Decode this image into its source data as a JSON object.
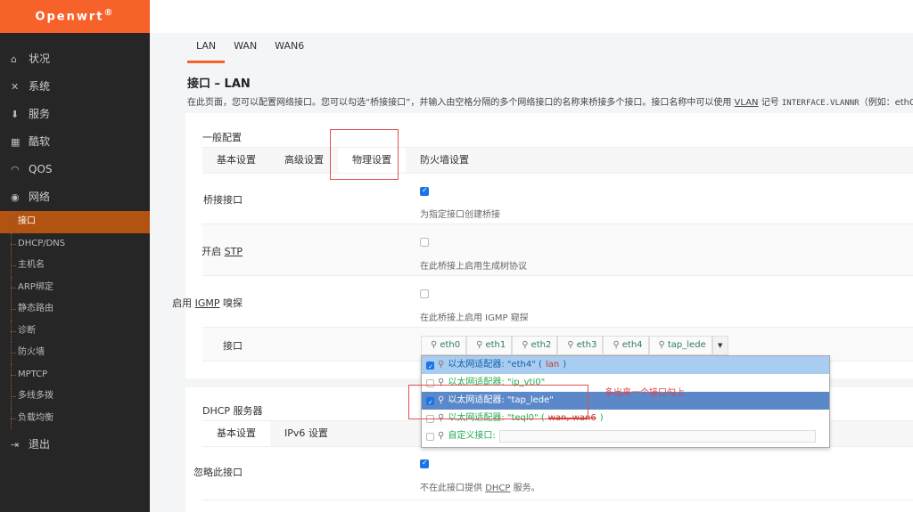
{
  "brand": {
    "name": "Openwrt",
    "mark": "®",
    "color": "#f6622a"
  },
  "sidebar": {
    "items": [
      {
        "icon": "home-icon",
        "glyph": "⌂",
        "label": "状况"
      },
      {
        "icon": "tools-icon",
        "glyph": "✕",
        "label": "系统"
      },
      {
        "icon": "download-icon",
        "glyph": "⬇",
        "label": "服务"
      },
      {
        "icon": "calendar-icon",
        "glyph": "▦",
        "label": "酷软"
      },
      {
        "icon": "gauge-icon",
        "glyph": "◠",
        "label": "QOS"
      },
      {
        "icon": "globe-icon",
        "glyph": "◉",
        "label": "网络"
      }
    ],
    "subitems": [
      "接口",
      "DHCP/DNS",
      "主机名",
      "ARP绑定",
      "静态路由",
      "诊断",
      "防火墙",
      "MPTCP",
      "多线多拨",
      "负载均衡"
    ],
    "logout": {
      "icon": "logout-icon",
      "glyph": "⇥",
      "label": "退出"
    }
  },
  "tabs": [
    "LAN",
    "WAN",
    "WAN6"
  ],
  "page": {
    "title": "接口 – LAN",
    "desc_prefix": "在此页面，您可以配置网络接口。您可以勾选“桥接接口”，并输入由空格分隔的多个网络接口的名称来桥接多个接口。接口名称中可以使用 ",
    "desc_vlan": "VLAN",
    "desc_mid": " 记号 ",
    "desc_mono": "INTERFACE.VLANNR",
    "desc_suffix": "（例如：eth0"
  },
  "general": {
    "title": "一般配置",
    "tabs": [
      "基本设置",
      "高级设置",
      "物理设置",
      "防火墙设置"
    ],
    "bridge": {
      "label": "桥接接口",
      "checked": true,
      "help": "为指定接口创建桥接"
    },
    "stp": {
      "prefix": "开启 ",
      "abbr": "STP",
      "help": "在此桥接上启用生成树协议"
    },
    "igmp": {
      "prefix": "启用 ",
      "abbr": "IGMP",
      "suffix": " 嗅探",
      "help": "在此桥接上启用 IGMP 窥探"
    },
    "iface_label": "接口",
    "ifaces": [
      "eth0",
      "eth1",
      "eth2",
      "eth3",
      "eth4",
      "tap_lede"
    ]
  },
  "dropdown": {
    "items": [
      {
        "text": "以太网适配器: \"eth4\" (",
        "zone": "lan",
        "end": ")",
        "checked": true
      },
      {
        "text": "以太网适配器: \"ip_vti0\"",
        "zone": "",
        "end": "",
        "checked": false
      },
      {
        "text": "以太网适配器: \"tap_lede\"",
        "zone": "",
        "end": "",
        "checked": true
      },
      {
        "text": "以太网适配器: \"teql0\" (",
        "zone": "wan, wan6",
        "end": ")",
        "checked": false
      }
    ],
    "custom_label": "自定义接口:"
  },
  "annotation": "多出来一个接口勾上",
  "dhcp": {
    "title": "DHCP 服务器",
    "tabs": [
      "基本设置",
      "IPv6 设置"
    ],
    "ignore": {
      "label": "忽略此接口",
      "checked": true,
      "help_prefix": "不在此接口提供 ",
      "help_abbr": "DHCP",
      "help_suffix": " 服务。"
    }
  }
}
